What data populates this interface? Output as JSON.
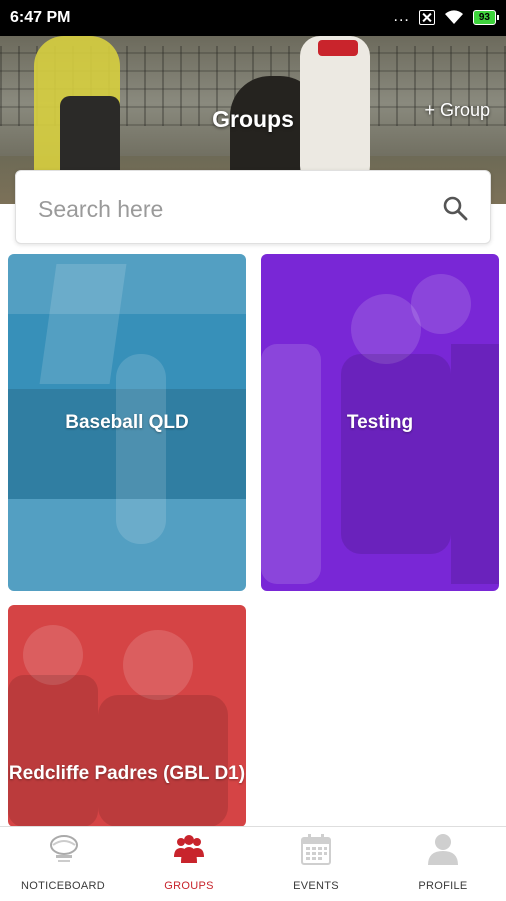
{
  "status_bar": {
    "time": "6:47 PM",
    "dots": "...",
    "battery": "93"
  },
  "header": {
    "title": "Groups",
    "add_button_label": "+ Group"
  },
  "search": {
    "placeholder": "Search here",
    "value": ""
  },
  "groups": [
    {
      "name": "Baseball QLD",
      "color": "#3790b9"
    },
    {
      "name": "Testing",
      "color": "#7927d6"
    },
    {
      "name": "Redcliffe Padres (GBL D1)",
      "color": "#d54445"
    }
  ],
  "bottom_nav": {
    "active": "GROUPS",
    "items": [
      {
        "label": "NOTICEBOARD",
        "icon": "baseball-logo-icon"
      },
      {
        "label": "GROUPS",
        "icon": "groups-icon"
      },
      {
        "label": "EVENTS",
        "icon": "calendar-icon"
      },
      {
        "label": "PROFILE",
        "icon": "person-icon"
      }
    ]
  },
  "colors": {
    "accent": "#c8242c",
    "inactive_icon": "#cccccc"
  }
}
